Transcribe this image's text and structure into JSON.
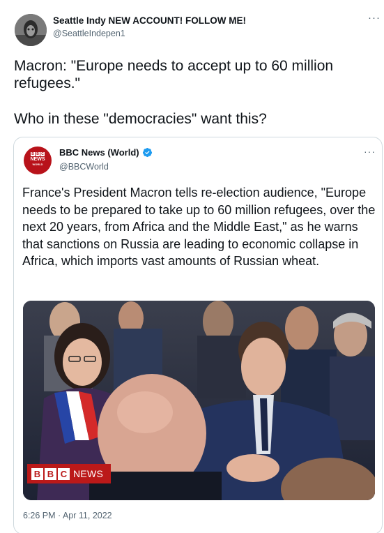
{
  "tweet": {
    "author": {
      "display_name": "Seattle Indy NEW ACCOUNT! FOLLOW ME!",
      "handle": "@SeattleIndepen1"
    },
    "more_label": "···",
    "text_line1": "Macron: \"Europe needs to accept up to 60 million refugees.\"",
    "text_line2": "Who in these \"democracies\" want this?"
  },
  "quoted_tweet": {
    "author": {
      "display_name": "BBC News (World)",
      "handle": "@BBCWorld",
      "verified": true
    },
    "avatar_logo": {
      "boxes": [
        "B",
        "B",
        "C"
      ],
      "line1": "NEWS",
      "line2": "WORLD"
    },
    "more_label": "···",
    "text": "France's President Macron tells re-election audience, \"Europe needs to be prepared to take up to 60 million refugees, over the next 20 years, from Africa and the Middle East,\" as he warns that sanctions on Russia are leading to economic collapse in Africa, which imports vast amounts of Russian wheat.",
    "image_watermark": {
      "letters": [
        "B",
        "B",
        "C"
      ],
      "word": "NEWS"
    },
    "timestamp": "6:26 PM · Apr 11, 2022"
  },
  "colors": {
    "text_primary": "#0f1419",
    "text_secondary": "#536471",
    "border": "#cfd9de",
    "bbc_red": "#bb1919",
    "verified_blue": "#1d9bf0"
  }
}
